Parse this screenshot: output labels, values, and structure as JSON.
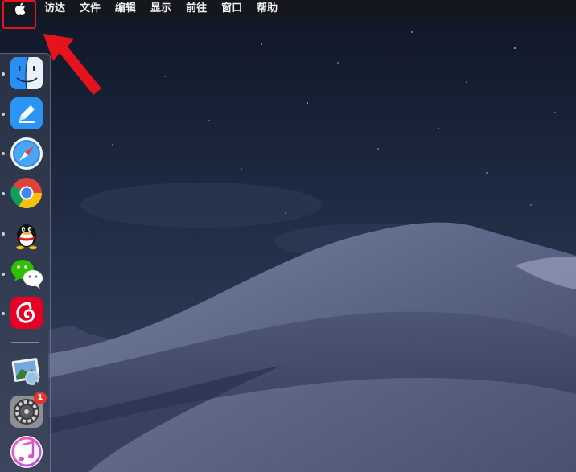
{
  "menubar": {
    "apple_icon": "apple-logo-icon",
    "items": [
      "访达",
      "文件",
      "编辑",
      "显示",
      "前往",
      "窗口",
      "帮助"
    ]
  },
  "annotation": {
    "highlight_color": "#e3141b",
    "arrow_color": "#e3141b"
  },
  "dock": {
    "apps": [
      {
        "icon": "finder-icon",
        "running": true
      },
      {
        "icon": "pen-app-icon",
        "running": true
      },
      {
        "icon": "safari-icon",
        "running": true
      },
      {
        "icon": "chrome-icon",
        "running": true
      },
      {
        "icon": "qq-icon",
        "running": true
      },
      {
        "icon": "wechat-icon",
        "running": true
      },
      {
        "icon": "netease-music-icon",
        "running": true
      },
      {
        "icon": "preview-icon",
        "running": false
      },
      {
        "icon": "system-preferences-icon",
        "running": false,
        "badge": "1"
      },
      {
        "icon": "itunes-icon",
        "running": false
      }
    ]
  }
}
